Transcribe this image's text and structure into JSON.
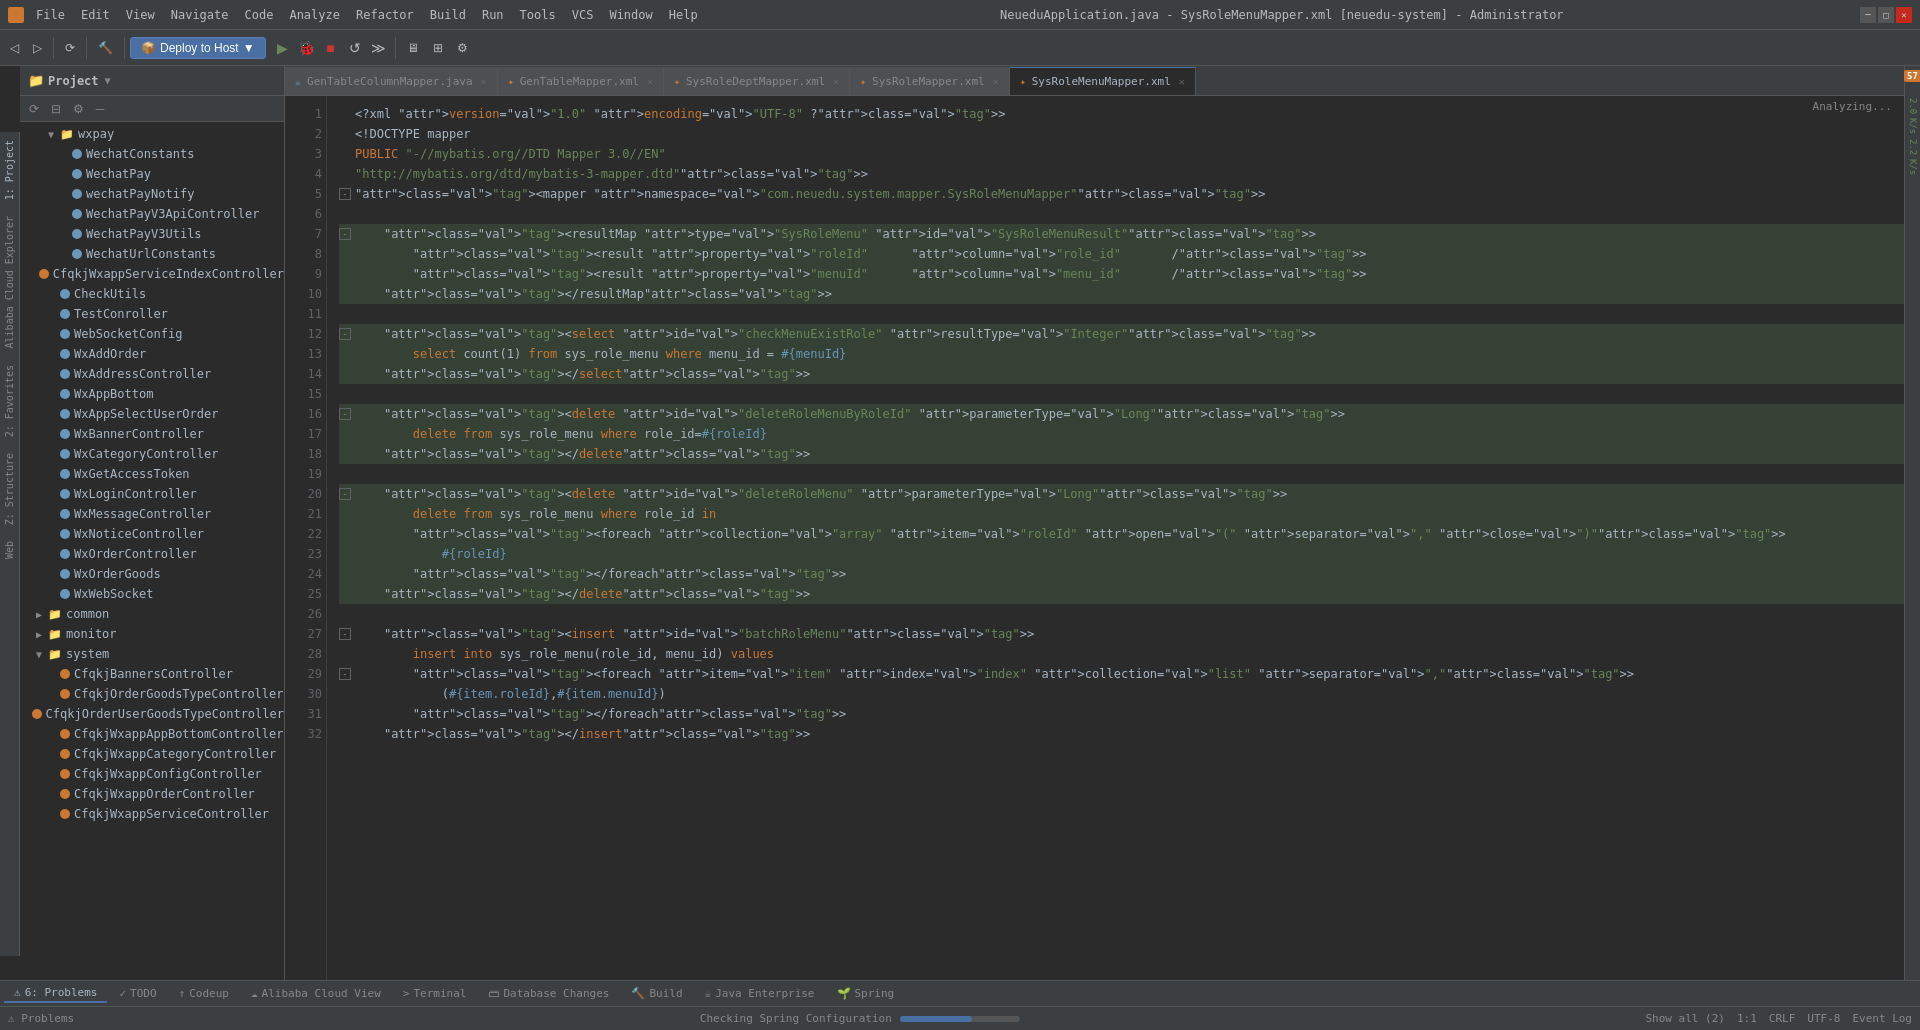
{
  "titlebar": {
    "app_title": "NeueduApplication.java - SysRoleMenuMapper.xml [neuedu-system] - Administrator",
    "menu_items": [
      "File",
      "Edit",
      "View",
      "Navigate",
      "Code",
      "Analyze",
      "Refactor",
      "Build",
      "Run",
      "Tools",
      "VCS",
      "Window",
      "Help"
    ]
  },
  "toolbar": {
    "deploy_label": "Deploy to Host",
    "deploy_dropdown": "▼"
  },
  "tabs": [
    {
      "name": "GenTableColumnMapper.java",
      "type": "java",
      "active": false
    },
    {
      "name": "GenTableMapper.xml",
      "type": "xml",
      "active": false
    },
    {
      "name": "SysRoleDeptMapper.xml",
      "type": "xml",
      "active": false
    },
    {
      "name": "SysRoleMapper.xml",
      "type": "xml",
      "active": false
    },
    {
      "name": "SysRoleMenuMapper.xml",
      "type": "xml",
      "active": true
    }
  ],
  "analyzing": "Analyzing...",
  "project": {
    "title": "Project",
    "files": [
      {
        "indent": 2,
        "type": "folder",
        "name": "wxpay",
        "open": true
      },
      {
        "indent": 3,
        "type": "file",
        "name": "WechatConstants"
      },
      {
        "indent": 3,
        "type": "file",
        "name": "WechatPay"
      },
      {
        "indent": 3,
        "type": "file",
        "name": "wechatPayNotify"
      },
      {
        "indent": 3,
        "type": "file",
        "name": "WechatPayV3ApiController"
      },
      {
        "indent": 3,
        "type": "file",
        "name": "WechatPayV3Utils"
      },
      {
        "indent": 3,
        "type": "file",
        "name": "WechatUrlConstants"
      },
      {
        "indent": 2,
        "type": "file_orange",
        "name": "CfqkjWxappServiceIndexController"
      },
      {
        "indent": 2,
        "type": "file",
        "name": "CheckUtils"
      },
      {
        "indent": 2,
        "type": "file",
        "name": "TestConroller"
      },
      {
        "indent": 2,
        "type": "file",
        "name": "WebSocketConfig"
      },
      {
        "indent": 2,
        "type": "file",
        "name": "WxAddOrder"
      },
      {
        "indent": 2,
        "type": "file",
        "name": "WxAddressController"
      },
      {
        "indent": 2,
        "type": "file",
        "name": "WxAppBottom"
      },
      {
        "indent": 2,
        "type": "file",
        "name": "WxAppSelectUserOrder"
      },
      {
        "indent": 2,
        "type": "file",
        "name": "WxBannerController"
      },
      {
        "indent": 2,
        "type": "file",
        "name": "WxCategoryController"
      },
      {
        "indent": 2,
        "type": "file",
        "name": "WxGetAccessToken"
      },
      {
        "indent": 2,
        "type": "file",
        "name": "WxLoginController"
      },
      {
        "indent": 2,
        "type": "file",
        "name": "WxMessageController"
      },
      {
        "indent": 2,
        "type": "file",
        "name": "WxNoticeController"
      },
      {
        "indent": 2,
        "type": "file",
        "name": "WxOrderController"
      },
      {
        "indent": 2,
        "type": "file",
        "name": "WxOrderGoods"
      },
      {
        "indent": 2,
        "type": "file",
        "name": "WxWebSocket"
      },
      {
        "indent": 1,
        "type": "folder_closed",
        "name": "common"
      },
      {
        "indent": 1,
        "type": "folder_closed",
        "name": "monitor"
      },
      {
        "indent": 1,
        "type": "folder_open",
        "name": "system",
        "open": true
      },
      {
        "indent": 2,
        "type": "file_orange",
        "name": "CfqkjBannersController"
      },
      {
        "indent": 2,
        "type": "file_orange",
        "name": "CfqkjOrderGoodsTypeController"
      },
      {
        "indent": 2,
        "type": "file_orange",
        "name": "CfqkjOrderUserGoodsTypeController"
      },
      {
        "indent": 2,
        "type": "file_orange",
        "name": "CfqkjWxappAppBottomController"
      },
      {
        "indent": 2,
        "type": "file_orange",
        "name": "CfqkjWxappCategoryController"
      },
      {
        "indent": 2,
        "type": "file_orange",
        "name": "CfqkjWxappConfigController"
      },
      {
        "indent": 2,
        "type": "file_orange",
        "name": "CfqkjWxappOrderController"
      },
      {
        "indent": 2,
        "type": "file_orange",
        "name": "CfqkjWxappServiceController"
      }
    ]
  },
  "code_lines": [
    {
      "num": 1,
      "fold": false,
      "highlight": false,
      "content": "<?xml version=\"1.0\" encoding=\"UTF-8\" ?>"
    },
    {
      "num": 2,
      "fold": false,
      "highlight": false,
      "content": "<!DOCTYPE mapper"
    },
    {
      "num": 3,
      "fold": false,
      "highlight": false,
      "content": "PUBLIC \"-//mybatis.org//DTD Mapper 3.0//EN\""
    },
    {
      "num": 4,
      "fold": false,
      "highlight": false,
      "content": "\"http://mybatis.org/dtd/mybatis-3-mapper.dtd\">"
    },
    {
      "num": 5,
      "fold": true,
      "highlight": false,
      "content": "<mapper namespace=\"com.neuedu.system.mapper.SysRoleMenuMapper\">"
    },
    {
      "num": 6,
      "fold": false,
      "highlight": false,
      "content": ""
    },
    {
      "num": 7,
      "fold": true,
      "highlight": true,
      "content": "    <resultMap type=\"SysRoleMenu\" id=\"SysRoleMenuResult\">"
    },
    {
      "num": 8,
      "fold": false,
      "highlight": true,
      "content": "        <result property=\"roleId\"      column=\"role_id\"       />"
    },
    {
      "num": 9,
      "fold": false,
      "highlight": true,
      "content": "        <result property=\"menuId\"      column=\"menu_id\"       />"
    },
    {
      "num": 10,
      "fold": false,
      "highlight": true,
      "content": "    </resultMap>"
    },
    {
      "num": 11,
      "fold": false,
      "highlight": false,
      "content": ""
    },
    {
      "num": 12,
      "fold": true,
      "highlight": true,
      "content": "    <select id=\"checkMenuExistRole\" resultType=\"Integer\">"
    },
    {
      "num": 13,
      "fold": false,
      "highlight": true,
      "content": "        select count(1) from sys_role_menu where menu_id = #{menuId}"
    },
    {
      "num": 14,
      "fold": false,
      "highlight": true,
      "content": "    </select>"
    },
    {
      "num": 15,
      "fold": false,
      "highlight": false,
      "content": ""
    },
    {
      "num": 16,
      "fold": true,
      "highlight": true,
      "content": "    <delete id=\"deleteRoleMenuByRoleId\" parameterType=\"Long\">"
    },
    {
      "num": 17,
      "fold": false,
      "highlight": true,
      "content": "        delete from sys_role_menu where role_id=#{roleId}"
    },
    {
      "num": 18,
      "fold": false,
      "highlight": true,
      "content": "    </delete>"
    },
    {
      "num": 19,
      "fold": false,
      "highlight": false,
      "content": ""
    },
    {
      "num": 20,
      "fold": true,
      "highlight": true,
      "content": "    <delete id=\"deleteRoleMenu\" parameterType=\"Long\">"
    },
    {
      "num": 21,
      "fold": false,
      "highlight": true,
      "content": "        delete from sys_role_menu where role_id in"
    },
    {
      "num": 22,
      "fold": false,
      "highlight": true,
      "content": "        <foreach collection=\"array\" item=\"roleId\" open=\"(\" separator=\",\" close=\")\">"
    },
    {
      "num": 23,
      "fold": false,
      "highlight": true,
      "content": "            #{roleId}"
    },
    {
      "num": 24,
      "fold": false,
      "highlight": true,
      "content": "        </foreach>"
    },
    {
      "num": 25,
      "fold": false,
      "highlight": true,
      "content": "    </delete>"
    },
    {
      "num": 26,
      "fold": false,
      "highlight": false,
      "content": ""
    },
    {
      "num": 27,
      "fold": true,
      "highlight": false,
      "content": "    <insert id=\"batchRoleMenu\">"
    },
    {
      "num": 28,
      "fold": false,
      "highlight": false,
      "content": "        insert into sys_role_menu(role_id, menu_id) values"
    },
    {
      "num": 29,
      "fold": true,
      "highlight": false,
      "content": "        <foreach item=\"item\" index=\"index\" collection=\"list\" separator=\",\">"
    },
    {
      "num": 30,
      "fold": false,
      "highlight": false,
      "content": "            (#{item.roleId},#{item.menuId})"
    },
    {
      "num": 31,
      "fold": false,
      "highlight": false,
      "content": "        </foreach>"
    },
    {
      "num": 32,
      "fold": false,
      "highlight": false,
      "content": "    </insert>"
    }
  ],
  "status_bar": {
    "checking_text": "Checking Spring Configuration",
    "progress": 60,
    "show_all": "Show all (2)",
    "position": "1:1",
    "line_sep": "CRLF",
    "encoding": "UTF-8"
  },
  "bottom_tabs": [
    {
      "label": "6: Problems",
      "icon": "⚠"
    },
    {
      "label": "TODO",
      "icon": "✓"
    },
    {
      "label": "Codeup",
      "icon": "↑"
    },
    {
      "label": "Alibaba Cloud View",
      "icon": "☁"
    },
    {
      "label": "Terminal",
      "icon": ">"
    },
    {
      "label": "Database Changes",
      "icon": "🗃"
    },
    {
      "label": "Build",
      "icon": "🔨"
    },
    {
      "label": "Java Enterprise",
      "icon": "☕"
    },
    {
      "label": "Spring",
      "icon": "🌱"
    }
  ],
  "right_badges": {
    "speed1": "2.0",
    "speed2": "2.2",
    "unit": "K/s",
    "count": "57"
  },
  "left_panel_labels": [
    "1: Project",
    "Alibaba Cloud Explorer",
    "2: Favorites",
    "Z: Structure",
    "Web"
  ]
}
